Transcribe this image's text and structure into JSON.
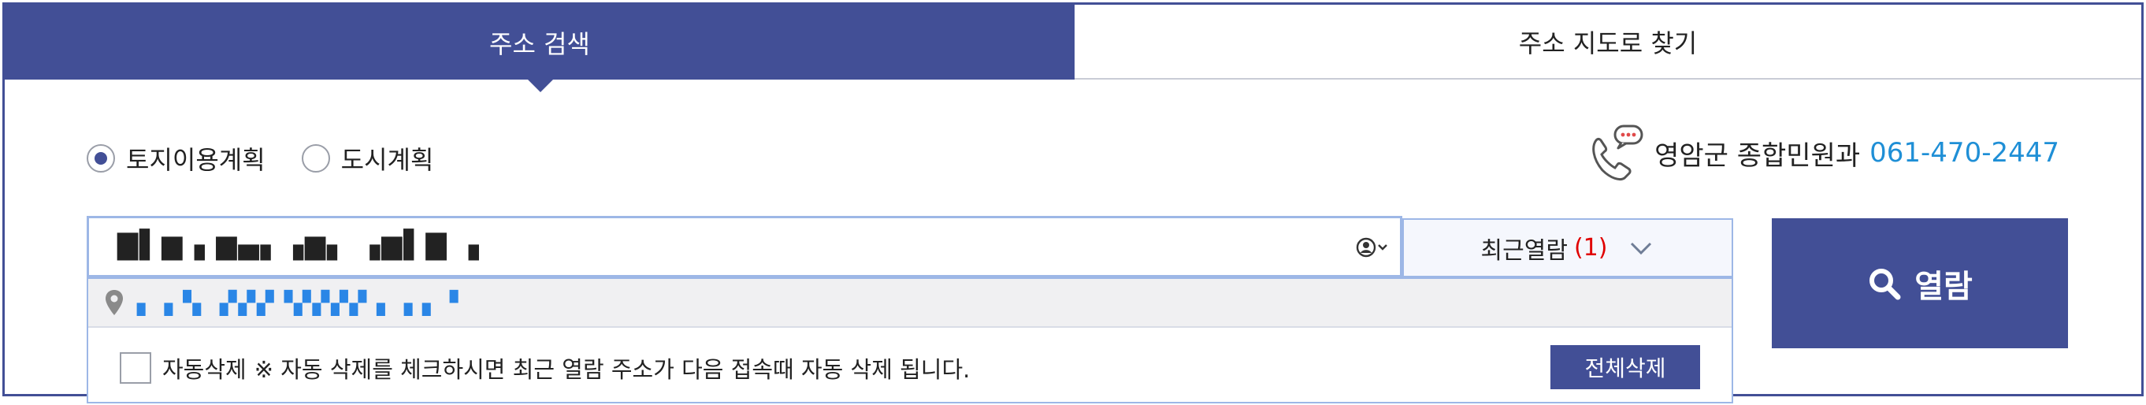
{
  "tabs": [
    {
      "label": "주소 검색",
      "active": true
    },
    {
      "label": "주소 지도로 찾기",
      "active": false
    }
  ],
  "radios": [
    {
      "label": "토지이용계획",
      "checked": true
    },
    {
      "label": "도시계획",
      "checked": false
    }
  ],
  "contact": {
    "label": "영암군 종합민원과",
    "phone": "061-470-2447",
    "icon": "phone-chat-icon"
  },
  "search": {
    "value": "▇▌▆▗ ▆▄▖▗▆▖ ▗▆▌▇ ▗"
  },
  "recent": {
    "label": "최근열람",
    "count": "(1)",
    "items": [
      {
        "text": "▖▗▝▖ ▞▞▞▝▞▞▞▞ ▖▗ ▖▝"
      }
    ]
  },
  "auto_delete": {
    "label": "자동삭제",
    "note": "※ 자동 삭제를 체크하시면 최근 열람 주소가 다음 접속때 자동 삭제 됩니다.",
    "checked": false
  },
  "buttons": {
    "view": "열람",
    "clear_all": "전체삭제"
  },
  "colors": {
    "brand": "#424f96",
    "phone": "#1f8fd6",
    "count": "#e00000",
    "input_border": "#9db7e6"
  }
}
